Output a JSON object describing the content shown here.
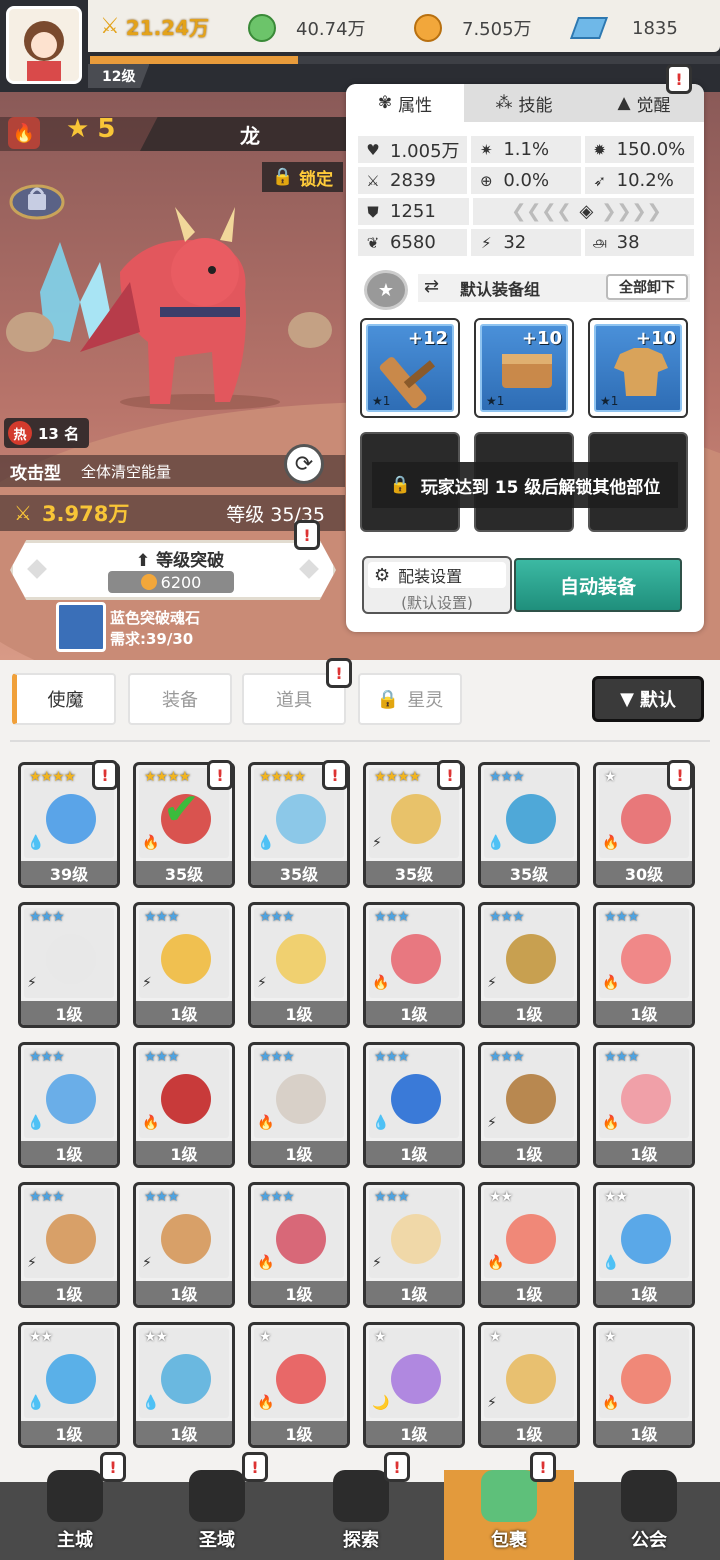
{
  "top": {
    "level": "12级",
    "power": "21.24万",
    "green_gem": "40.74万",
    "gold": "7.505万",
    "crystal": "1835",
    "xp_fraction": 0.33
  },
  "hero": {
    "stars": "5",
    "name": "龙",
    "lock_label": "锁定",
    "rank_hot": "热",
    "rank": "13 名",
    "type": "攻击型",
    "skill_desc": "全体清空能量",
    "power": "3.978万",
    "level": "等级 35/35",
    "breakthrough_label": "等级突破",
    "breakthrough_cost": "6200",
    "soul_name": "蓝色突破魂石",
    "soul_need": "需求:39/30"
  },
  "panel": {
    "tabs": [
      "属性",
      "技能",
      "觉醒"
    ],
    "stats": [
      [
        "1.005万",
        "1.1%",
        "150.0%"
      ],
      [
        "2839",
        "0.0%",
        "10.2%"
      ],
      [
        "1251",
        "",
        ""
      ],
      [
        "6580",
        "32",
        "38"
      ]
    ],
    "set_name": "默认装备组",
    "unequip_all": "全部卸下",
    "equip": [
      {
        "plus": "+12",
        "stars": "★1"
      },
      {
        "plus": "+10",
        "stars": "★1"
      },
      {
        "plus": "+10",
        "stars": "★1"
      }
    ],
    "lock_msg": "玩家达到 15 级后解锁其他部位",
    "config_label": "配装设置",
    "config_sub": "(默认设置)",
    "auto_equip": "自动装备"
  },
  "bag_tabs": [
    "使魔",
    "装备",
    "道具",
    "星灵"
  ],
  "sort_label": "默认",
  "cards": [
    {
      "stars": "★★★★",
      "level": "39级",
      "color": "#5aa4e8",
      "elem": "💧"
    },
    {
      "stars": "★★★★",
      "level": "35级",
      "color": "#d9534f",
      "elem": "🔥"
    },
    {
      "stars": "★★★★",
      "level": "35级",
      "color": "#8cc8e8",
      "elem": "💧"
    },
    {
      "stars": "★★★★",
      "level": "35级",
      "color": "#e8c26a",
      "elem": "⚡"
    },
    {
      "stars": "★★★",
      "level": "35级",
      "color": "#4fa8d8",
      "elem": "💧"
    },
    {
      "stars": "★",
      "level": "30级",
      "color": "#e8787a",
      "elem": "🔥"
    },
    {
      "stars": "★★★",
      "level": "1级",
      "color": "#e8e8e8",
      "elem": "⚡"
    },
    {
      "stars": "★★★",
      "level": "1级",
      "color": "#f0c050",
      "elem": "⚡"
    },
    {
      "stars": "★★★",
      "level": "1级",
      "color": "#f0d070",
      "elem": "⚡"
    },
    {
      "stars": "★★★",
      "level": "1级",
      "color": "#e87880",
      "elem": "🔥"
    },
    {
      "stars": "★★★",
      "level": "1级",
      "color": "#c8a050",
      "elem": "⚡"
    },
    {
      "stars": "★★★",
      "level": "1级",
      "color": "#f08888",
      "elem": "🔥"
    },
    {
      "stars": "★★★",
      "level": "1级",
      "color": "#6aaee8",
      "elem": "💧"
    },
    {
      "stars": "★★★",
      "level": "1级",
      "color": "#c83a3a",
      "elem": "🔥"
    },
    {
      "stars": "★★★",
      "level": "1级",
      "color": "#d8d0c8",
      "elem": "🔥"
    },
    {
      "stars": "★★★",
      "level": "1级",
      "color": "#3a7ad8",
      "elem": "💧"
    },
    {
      "stars": "★★★",
      "level": "1级",
      "color": "#b88850",
      "elem": "⚡"
    },
    {
      "stars": "★★★",
      "level": "1级",
      "color": "#f0a0a8",
      "elem": "🔥"
    },
    {
      "stars": "★★★",
      "level": "1级",
      "color": "#d8a068",
      "elem": "⚡"
    },
    {
      "stars": "★★★",
      "level": "1级",
      "color": "#d8a068",
      "elem": "⚡"
    },
    {
      "stars": "★★★",
      "level": "1级",
      "color": "#d86878",
      "elem": "🔥"
    },
    {
      "stars": "★★★",
      "level": "1级",
      "color": "#f0d8a8",
      "elem": "⚡"
    },
    {
      "stars": "★★",
      "level": "1级",
      "color": "#f08878",
      "elem": "🔥"
    },
    {
      "stars": "★★",
      "level": "1级",
      "color": "#5aa8e8",
      "elem": "💧"
    },
    {
      "stars": "★★",
      "level": "1级",
      "color": "#5ab0e8",
      "elem": "💧"
    },
    {
      "stars": "★★",
      "level": "1级",
      "color": "#6ab8e0",
      "elem": "💧"
    },
    {
      "stars": "★",
      "level": "1级",
      "color": "#e86868",
      "elem": "🔥"
    },
    {
      "stars": "★",
      "level": "1级",
      "color": "#b088e0",
      "elem": "🌙"
    },
    {
      "stars": "★",
      "level": "1级",
      "color": "#e8c070",
      "elem": "⚡"
    },
    {
      "stars": "★",
      "level": "1级",
      "color": "#f08878",
      "elem": "🔥"
    }
  ],
  "nav": [
    "主城",
    "圣域",
    "探索",
    "包裹",
    "公会"
  ]
}
